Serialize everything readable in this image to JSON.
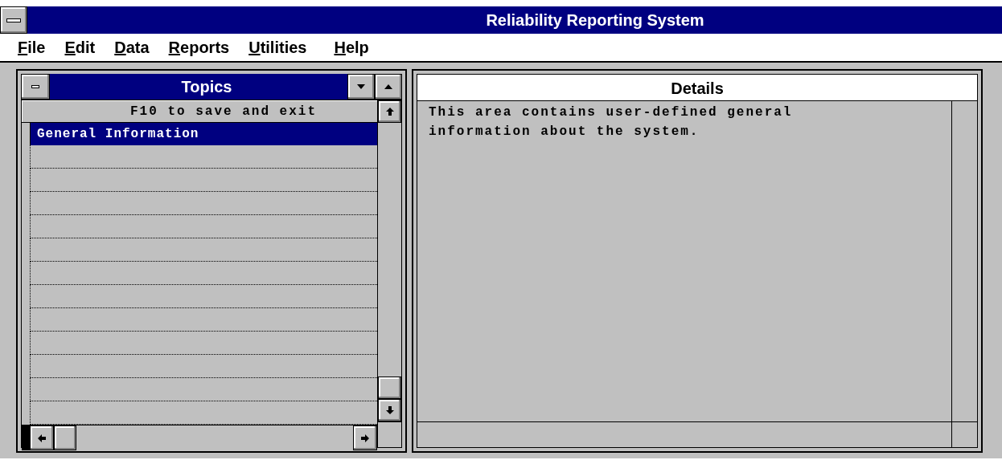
{
  "window": {
    "title": "Reliability Reporting System"
  },
  "menu": [
    {
      "accel": "F",
      "rest": "ile"
    },
    {
      "accel": "E",
      "rest": "dit"
    },
    {
      "accel": "D",
      "rest": "ata"
    },
    {
      "accel": "R",
      "rest": "eports"
    },
    {
      "accel": "U",
      "rest": "tilities"
    },
    {
      "accel": "H",
      "rest": "elp"
    }
  ],
  "topics": {
    "title": "Topics",
    "header": "F10 to save and exit",
    "items": [
      {
        "label": "General Information",
        "selected": true
      }
    ]
  },
  "details": {
    "title": "Details",
    "text": "This area contains user-defined general information about the system."
  }
}
